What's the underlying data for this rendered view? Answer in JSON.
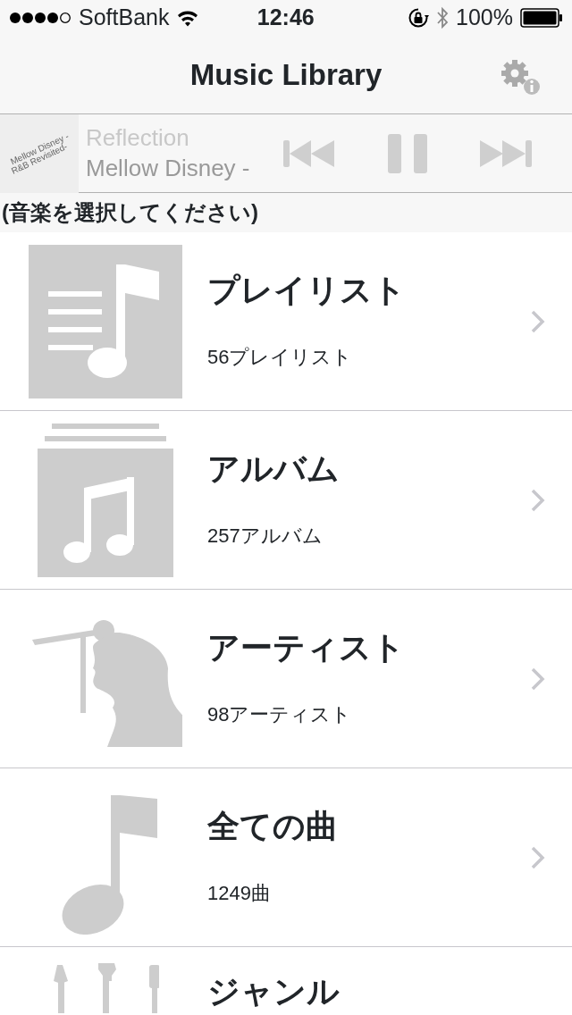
{
  "status_bar": {
    "carrier": "SoftBank",
    "time": "12:46",
    "battery": "100%"
  },
  "nav": {
    "title": "Music Library"
  },
  "player": {
    "art_text": [
      "Mellow Disney -",
      "R&B Revisited-"
    ],
    "title": "Reflection",
    "artist": "Mellow Disney -",
    "disabled": true
  },
  "section_header": "(音楽を選択してください)",
  "rows": [
    {
      "kind": "playlist",
      "title": "プレイリスト",
      "subtitle": "56プレイリスト"
    },
    {
      "kind": "album",
      "title": "アルバム",
      "subtitle": "257アルバム"
    },
    {
      "kind": "artist",
      "title": "アーティスト",
      "subtitle": "98アーティスト"
    },
    {
      "kind": "song",
      "title": "全ての曲",
      "subtitle": "1249曲"
    },
    {
      "kind": "genre",
      "title": "ジャンル"
    }
  ]
}
